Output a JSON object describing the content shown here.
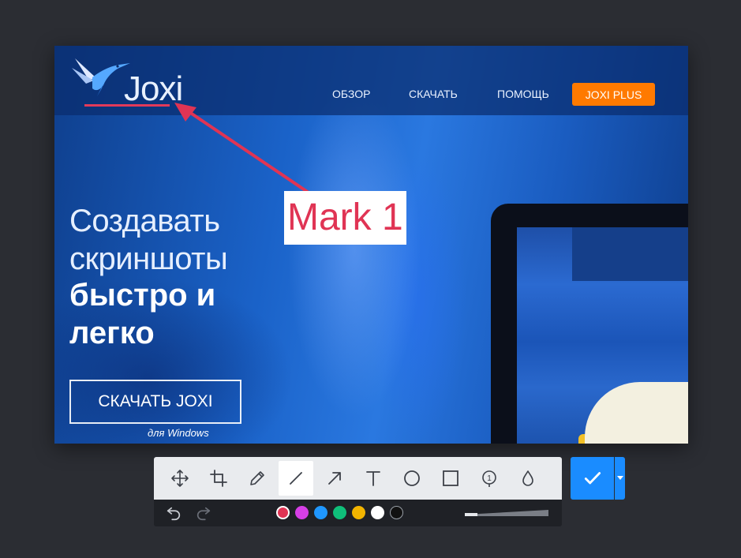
{
  "site": {
    "logo_text": "Joxi",
    "nav": {
      "overview": "ОБЗОР",
      "download": "СКАЧАТЬ",
      "help": "ПОМОЩЬ",
      "plus": "JOXI PLUS"
    },
    "hero": {
      "line1": "Создавать",
      "line2": "скриншоты",
      "line3": "быстро и",
      "line4": "легко",
      "button": "СКАЧАТЬ JOXI",
      "sub": "для Windows"
    }
  },
  "annotation": {
    "label": "Mark 1",
    "color": "#e03454"
  },
  "toolbar": {
    "tools": [
      {
        "name": "move",
        "icon": "move-icon"
      },
      {
        "name": "crop",
        "icon": "crop-icon"
      },
      {
        "name": "pencil",
        "icon": "pencil-icon"
      },
      {
        "name": "line",
        "icon": "line-icon",
        "active": true
      },
      {
        "name": "arrow",
        "icon": "arrow-icon"
      },
      {
        "name": "text",
        "icon": "text-icon"
      },
      {
        "name": "ellipse",
        "icon": "circle-icon"
      },
      {
        "name": "rectangle",
        "icon": "square-icon"
      },
      {
        "name": "numbered-marker",
        "icon": "numbered-marker-icon"
      },
      {
        "name": "blur",
        "icon": "drop-icon"
      }
    ],
    "numbered_marker_digit": "1",
    "colors": [
      "#e03454",
      "#d63fe6",
      "#1f97ff",
      "#0fbf7a",
      "#f2b400",
      "#ffffff",
      "#111111"
    ],
    "selected_color": "#e03454",
    "accent": "#1a8cff"
  }
}
